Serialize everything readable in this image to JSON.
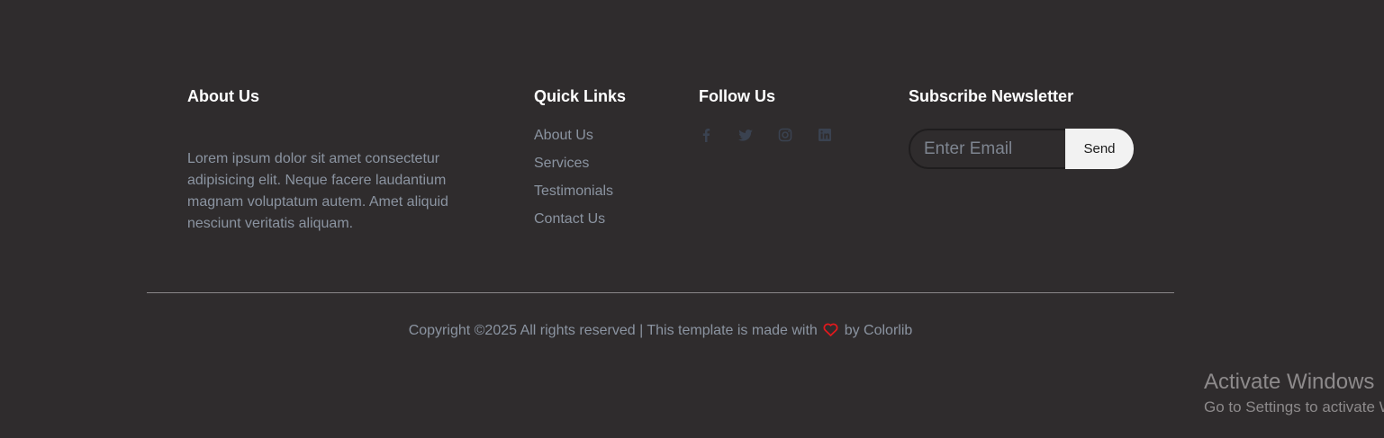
{
  "about": {
    "title": "About Us",
    "text": "Lorem ipsum dolor sit amet consectetur adipisicing elit. Neque facere laudantium magnam voluptatum autem. Amet aliquid nesciunt veritatis aliquam."
  },
  "quick_links": {
    "title": "Quick Links",
    "items": [
      {
        "label": "About Us"
      },
      {
        "label": "Services"
      },
      {
        "label": "Testimonials"
      },
      {
        "label": "Contact Us"
      }
    ]
  },
  "follow": {
    "title": "Follow Us",
    "icons": [
      "facebook-icon",
      "twitter-icon",
      "instagram-icon",
      "linkedin-icon"
    ],
    "icon_color": "#3a4250"
  },
  "newsletter": {
    "title": "Subscribe Newsletter",
    "placeholder": "Enter Email",
    "value": "",
    "button_label": "Send"
  },
  "copyright": {
    "prefix": "Copyright ©2025 All rights reserved | This template is made with",
    "suffix": "by",
    "link": "Colorlib",
    "heart_color": "#e0191d"
  },
  "watermark": {
    "title": "Activate Windows",
    "subtitle": "Go to Settings to activate Windows."
  },
  "colors": {
    "background": "#2f2c2d",
    "heading": "#ffffff",
    "text": "#8b94a1"
  }
}
